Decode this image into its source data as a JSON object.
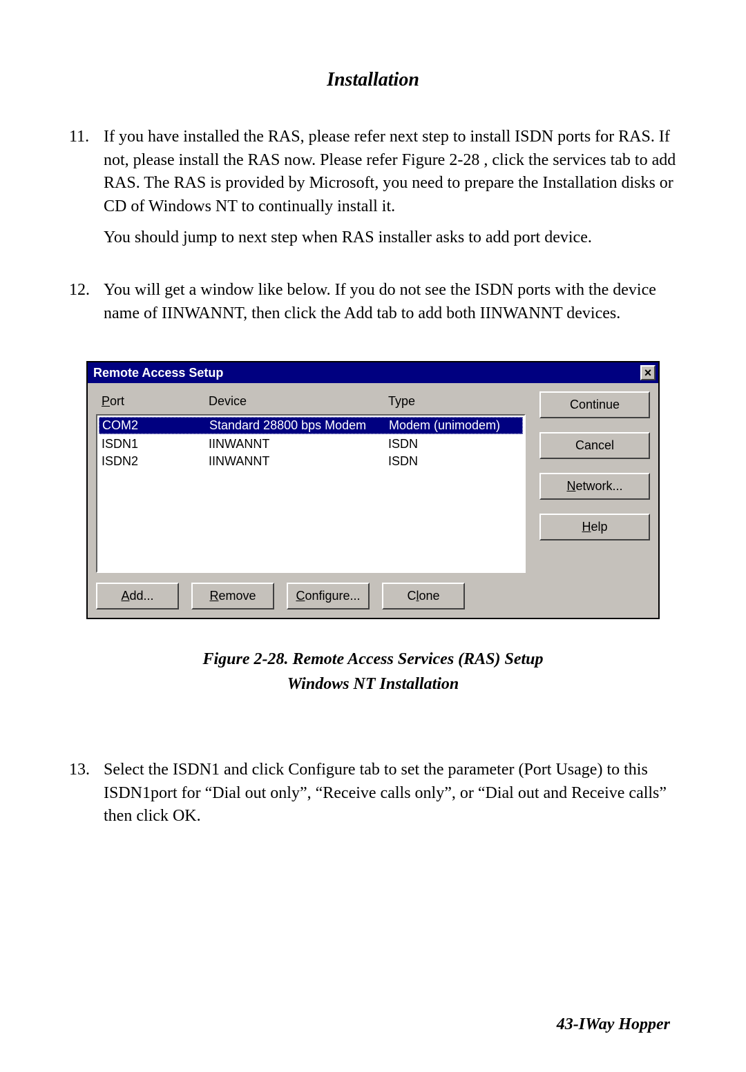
{
  "section_heading": "Installation",
  "steps": {
    "s11_num": "11.",
    "s11_p1": "If you have installed the RAS, please refer next step to install ISDN ports for RAS.  If not, please install the RAS now.  Please refer Figure 2-28 , click the services tab to add RAS.  The RAS is provided by Microsoft, you need to prepare the Installation disks or CD of Windows NT to continually install it.",
    "s11_p2": "You should jump to next step when RAS installer asks to add port device.",
    "s12_num": "12.",
    "s12_p1": "You will get a window like below.  If you do not see the ISDN ports with the device name of IINWANNT, then click the Add tab to add both IINWANNT devices.",
    "s13_num": "13.",
    "s13_p1": "Select the ISDN1 and click Configure tab to set the parameter (Port Usage) to this ISDN1port for “Dial out only”, “Receive calls only”, or “Dial out and Receive calls” then click OK."
  },
  "dialog": {
    "title": "Remote Access Setup",
    "close_glyph": "×",
    "headers": {
      "port": "Port",
      "device": "Device",
      "type": "Type"
    },
    "header_accel": {
      "port_u": "P",
      "port_rest": "ort"
    },
    "rows": [
      {
        "port": "COM2",
        "device": "Standard 28800 bps Modem",
        "type": "Modem (unimodem)",
        "selected": true
      },
      {
        "port": "ISDN1",
        "device": "IINWANNT",
        "type": "ISDN",
        "selected": false
      },
      {
        "port": "ISDN2",
        "device": "IINWANNT",
        "type": "ISDN",
        "selected": false
      }
    ],
    "right_buttons": {
      "continue": "Continue",
      "cancel": "Cancel",
      "network_u": "N",
      "network_rest": "etwork...",
      "help_u": "H",
      "help_rest": "elp"
    },
    "bottom_buttons": {
      "add_u": "A",
      "add_rest": "dd...",
      "remove_u": "R",
      "remove_rest": "emove",
      "configure_u": "C",
      "configure_rest": "onfigure...",
      "clone_pre": "C",
      "clone_u": "l",
      "clone_rest": "one"
    }
  },
  "figure": {
    "line1": "Figure 2-28. Remote Access Services (RAS) Setup",
    "line2": "Windows NT Installation"
  },
  "footer": "43-IWay Hopper"
}
